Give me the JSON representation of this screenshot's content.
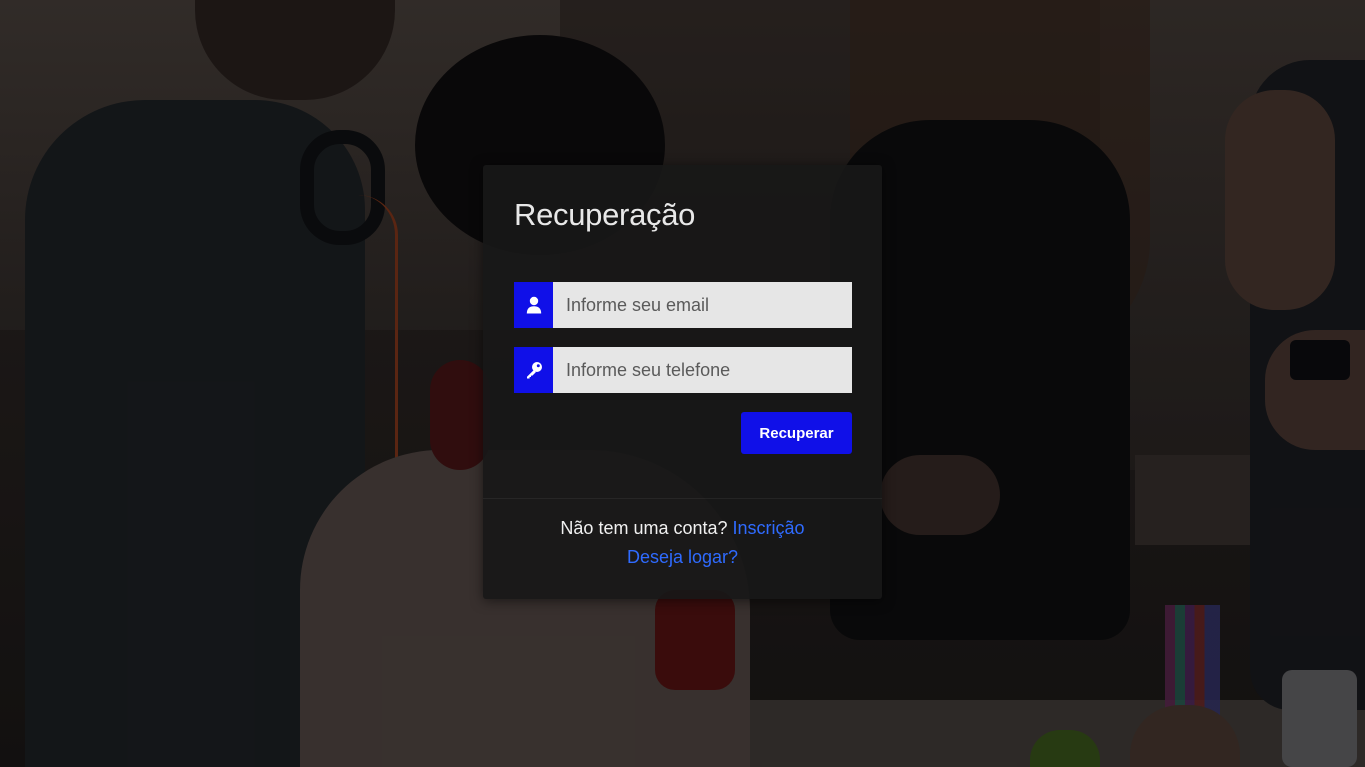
{
  "form": {
    "title": "Recuperação",
    "email": {
      "placeholder": "Informe seu email",
      "value": "",
      "icon": "user-icon"
    },
    "phone": {
      "placeholder": "Informe seu telefone",
      "value": "",
      "icon": "key-icon"
    },
    "submit_label": "Recuperar"
  },
  "footer": {
    "no_account_text": "Não tem uma conta?",
    "signup_link": "Inscrição",
    "login_link": "Deseja logar?"
  },
  "colors": {
    "accent": "#1010e8",
    "link": "#2f6bff",
    "card_background": "#181818",
    "input_background": "#e6e6e6"
  }
}
